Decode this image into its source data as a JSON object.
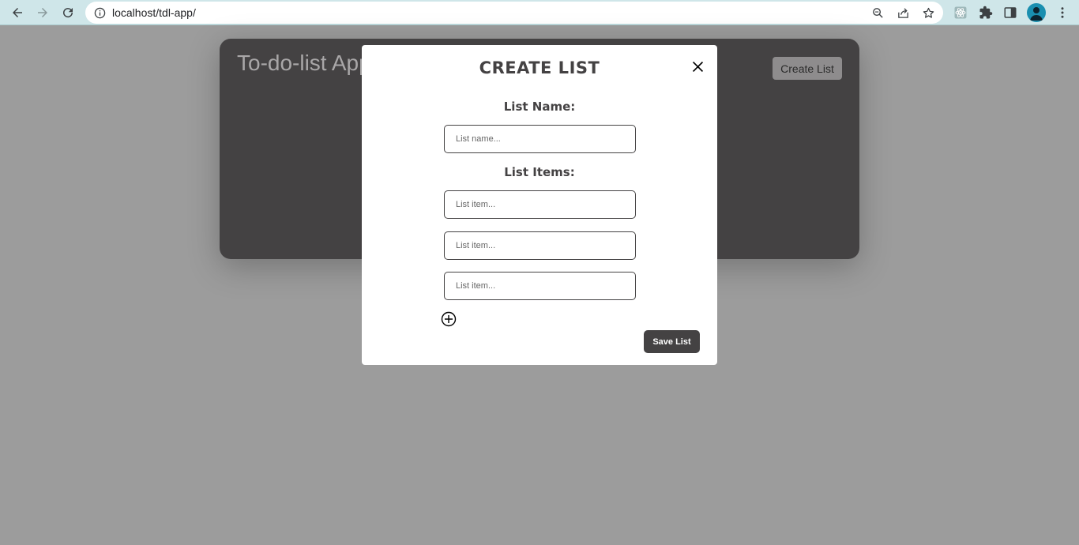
{
  "browser": {
    "url": "localhost/tdl-app/"
  },
  "app": {
    "title": "To-do-list App",
    "create_button": "Create List"
  },
  "modal": {
    "title": "CREATE LIST",
    "list_name_label": "List Name:",
    "list_name_placeholder": "List name...",
    "list_items_label": "List Items:",
    "items": [
      {
        "placeholder": "List item..."
      },
      {
        "placeholder": "List item..."
      },
      {
        "placeholder": "List item..."
      }
    ],
    "save_button": "Save List"
  },
  "colors": {
    "overlay": "#9c9c9c",
    "card": "#444243",
    "browser_bar": "#cfe6e9",
    "avatar": "#1a8fb0"
  },
  "icons": {
    "back": "arrow-left-icon",
    "forward": "arrow-right-icon",
    "reload": "reload-icon",
    "info": "info-icon",
    "zoom": "zoom-icon",
    "share": "share-icon",
    "bookmark": "star-icon",
    "react_devtools": "react-icon",
    "extensions": "puzzle-icon",
    "side_panel": "side-panel-icon",
    "profile": "avatar",
    "menu": "more-vert-icon",
    "close": "close-icon",
    "add_item": "plus-circle-icon"
  }
}
